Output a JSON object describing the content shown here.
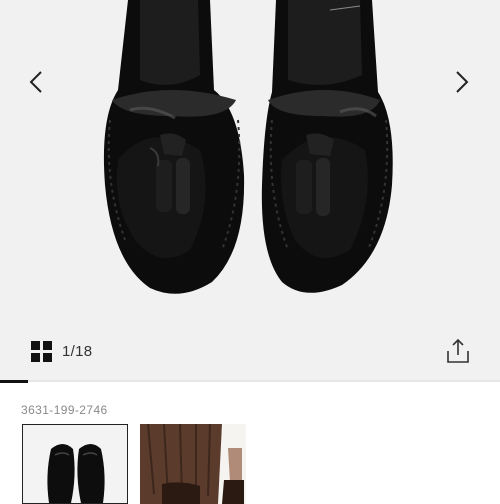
{
  "gallery": {
    "image_alt": "Black leather tassel loafers, top view",
    "prev_icon": "chevron-left-icon",
    "next_icon": "chevron-right-icon",
    "grid_icon": "grid-icon",
    "share_icon": "share-icon",
    "counter": "1/18",
    "progress": 0.056,
    "colors": {
      "background": "#f1f1f1",
      "shoe": "#0d0d0d",
      "track": "#e6e6e6",
      "fill": "#111111"
    }
  },
  "product": {
    "code": "3631-199-2746"
  },
  "thumbnails": [
    {
      "selected": true,
      "alt": "Black tassel loafers"
    },
    {
      "selected": false,
      "alt": "Model wearing loafers with brown skirt"
    }
  ]
}
